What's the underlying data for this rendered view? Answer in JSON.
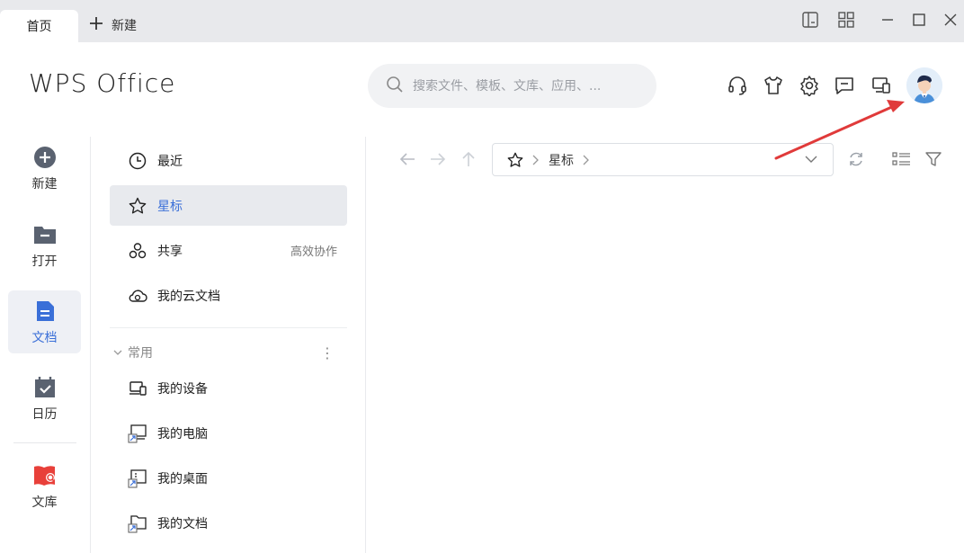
{
  "titlebar": {
    "tabs": [
      {
        "label": "首页",
        "active": true
      },
      {
        "label": "新建",
        "icon": "plus-icon"
      }
    ],
    "window_controls": [
      "sidebar-toggle-icon",
      "grid-apps-icon",
      "minimize-icon",
      "maximize-icon",
      "close-icon"
    ]
  },
  "header": {
    "logo": "WPS Office",
    "search": {
      "placeholder": "搜索文件、模板、文库、应用、..."
    },
    "icons": [
      "headset-icon",
      "tshirt-icon",
      "settings-icon",
      "message-icon",
      "device-sync-icon",
      "avatar"
    ]
  },
  "leftnav": {
    "items": [
      {
        "label": "新建",
        "icon": "plus-circle-icon",
        "active": false
      },
      {
        "label": "打开",
        "icon": "folder-icon",
        "active": false
      },
      {
        "label": "文档",
        "icon": "document-icon",
        "active": true
      },
      {
        "label": "日历",
        "icon": "calendar-icon",
        "active": false
      },
      {
        "label": "文库",
        "icon": "library-icon",
        "active": false
      }
    ]
  },
  "midpanel": {
    "items": [
      {
        "label": "最近",
        "icon": "clock-icon"
      },
      {
        "label": "星标",
        "icon": "star-icon",
        "active": true
      },
      {
        "label": "共享",
        "icon": "share-icon",
        "extra": "高效协作"
      },
      {
        "label": "我的云文档",
        "icon": "cloud-icon"
      }
    ],
    "section": {
      "label": "常用",
      "more": "⋮"
    },
    "common_items": [
      {
        "label": "我的设备",
        "icon": "device-icon"
      },
      {
        "label": "我的电脑",
        "icon": "computer-shortcut-icon"
      },
      {
        "label": "我的桌面",
        "icon": "desktop-shortcut-icon"
      },
      {
        "label": "我的文档",
        "icon": "documents-shortcut-icon"
      }
    ]
  },
  "toolbar": {
    "nav_icons": [
      "back-arrow-icon",
      "forward-arrow-icon",
      "up-arrow-icon"
    ],
    "path": {
      "root_icon": "star-icon",
      "segment": "星标"
    },
    "right_icons": [
      "refresh-icon",
      "list-view-icon",
      "filter-icon"
    ]
  },
  "colors": {
    "accent": "#3a6fd8",
    "titlebar_bg": "#e8e9ec",
    "annotation_arrow": "#e03a3a",
    "library_red": "#e8403a",
    "nav_icon_gray": "#5a6270"
  }
}
